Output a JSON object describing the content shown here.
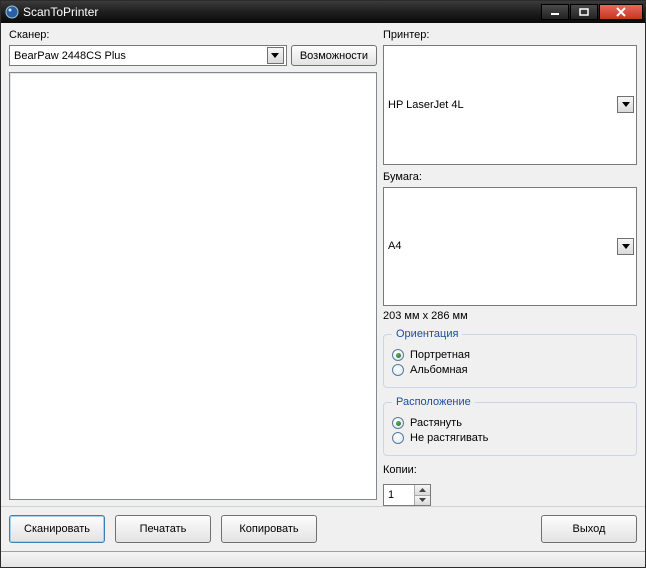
{
  "window": {
    "title": "ScanToPrinter"
  },
  "scanner": {
    "label": "Сканер:",
    "selected": "BearPaw 2448CS Plus",
    "capabilities_btn": "Возможности"
  },
  "printer": {
    "label": "Принтер:",
    "selected": "HP LaserJet 4L"
  },
  "paper": {
    "label": "Бумага:",
    "selected": "A4",
    "size_text": "203 мм x 286 мм"
  },
  "orientation": {
    "legend": "Ориентация",
    "portrait": "Портретная",
    "landscape": "Альбомная",
    "selected": "portrait"
  },
  "layout": {
    "legend": "Расположение",
    "stretch": "Растянуть",
    "nostretch": "Не растягивать",
    "selected": "stretch"
  },
  "copies": {
    "label": "Копии:",
    "value": "1"
  },
  "buttons": {
    "scan": "Сканировать",
    "print": "Печатать",
    "copy": "Копировать",
    "exit": "Выход"
  }
}
